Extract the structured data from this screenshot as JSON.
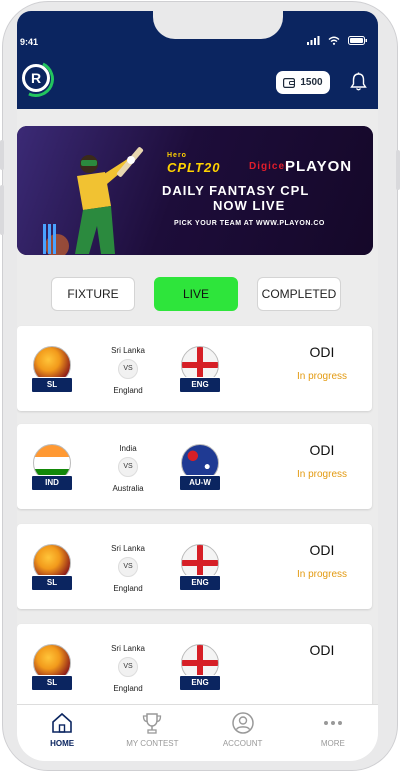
{
  "status_bar": {
    "time": "9:41"
  },
  "wallet": {
    "balance": "1500"
  },
  "banner": {
    "brand_top": "Hero",
    "brand": "CPLT20",
    "sponsor": "Digicel",
    "partner": "PLAYON",
    "headline_1": "DAILY FANTASY CPL",
    "headline_2": "NOW LIVE",
    "tagline": "PICK YOUR TEAM AT WWW.PLAYON.CO"
  },
  "tabs": [
    {
      "label": "FIXTURE"
    },
    {
      "label": "LIVE"
    },
    {
      "label": "COMPLETED"
    }
  ],
  "matches": [
    {
      "team1": {
        "code": "SL",
        "name": "Sri Lanka"
      },
      "vs": "VS",
      "team2": {
        "code": "ENG",
        "name": "England"
      },
      "format": "ODI",
      "status": "In progress"
    },
    {
      "team1": {
        "code": "IND",
        "name": "India"
      },
      "vs": "VS",
      "team2": {
        "code": "AU-W",
        "name": "Australia"
      },
      "format": "ODI",
      "status": "In progress"
    },
    {
      "team1": {
        "code": "SL",
        "name": "Sri Lanka"
      },
      "vs": "VS",
      "team2": {
        "code": "ENG",
        "name": "England"
      },
      "format": "ODI",
      "status": "In progress"
    },
    {
      "team1": {
        "code": "SL",
        "name": "Sri Lanka"
      },
      "vs": "VS",
      "team2": {
        "code": "ENG",
        "name": "England"
      },
      "format": "ODI",
      "status": ""
    }
  ],
  "nav": [
    {
      "label": "HOME",
      "icon": "home-icon"
    },
    {
      "label": "MY CONTEST",
      "icon": "trophy-icon"
    },
    {
      "label": "ACCOUNT",
      "icon": "user-icon"
    },
    {
      "label": "MORE",
      "icon": "more-icon"
    }
  ],
  "colors": {
    "primary": "#0b2560",
    "live_tab": "#2ee53b",
    "status": "#e39a10"
  }
}
